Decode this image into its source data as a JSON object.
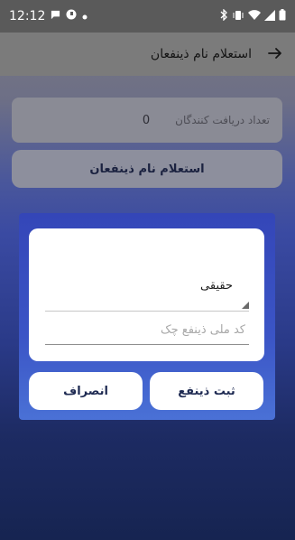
{
  "status_bar": {
    "time": "12:12",
    "left_icons": [
      "chat-bubble-icon",
      "media-icon",
      "dot-icon"
    ],
    "right_icons": [
      "bluetooth-icon",
      "vibrate-icon",
      "wifi-icon",
      "signal-icon",
      "battery-icon"
    ]
  },
  "app_bar": {
    "title": "استعلام نام ذینفعان",
    "back_icon": "arrow-right-icon"
  },
  "count_card": {
    "label": "تعداد دریافت کنندگان",
    "value": "0"
  },
  "inquiry_button": {
    "label": "استعلام نام ذینفعان"
  },
  "dialog": {
    "person_type": {
      "selected": "حقیقی"
    },
    "national_id": {
      "value": "",
      "placeholder": "کد ملی ذینفع چک"
    },
    "submit_label": "ثبت ذینفع",
    "cancel_label": "انصراف"
  }
}
